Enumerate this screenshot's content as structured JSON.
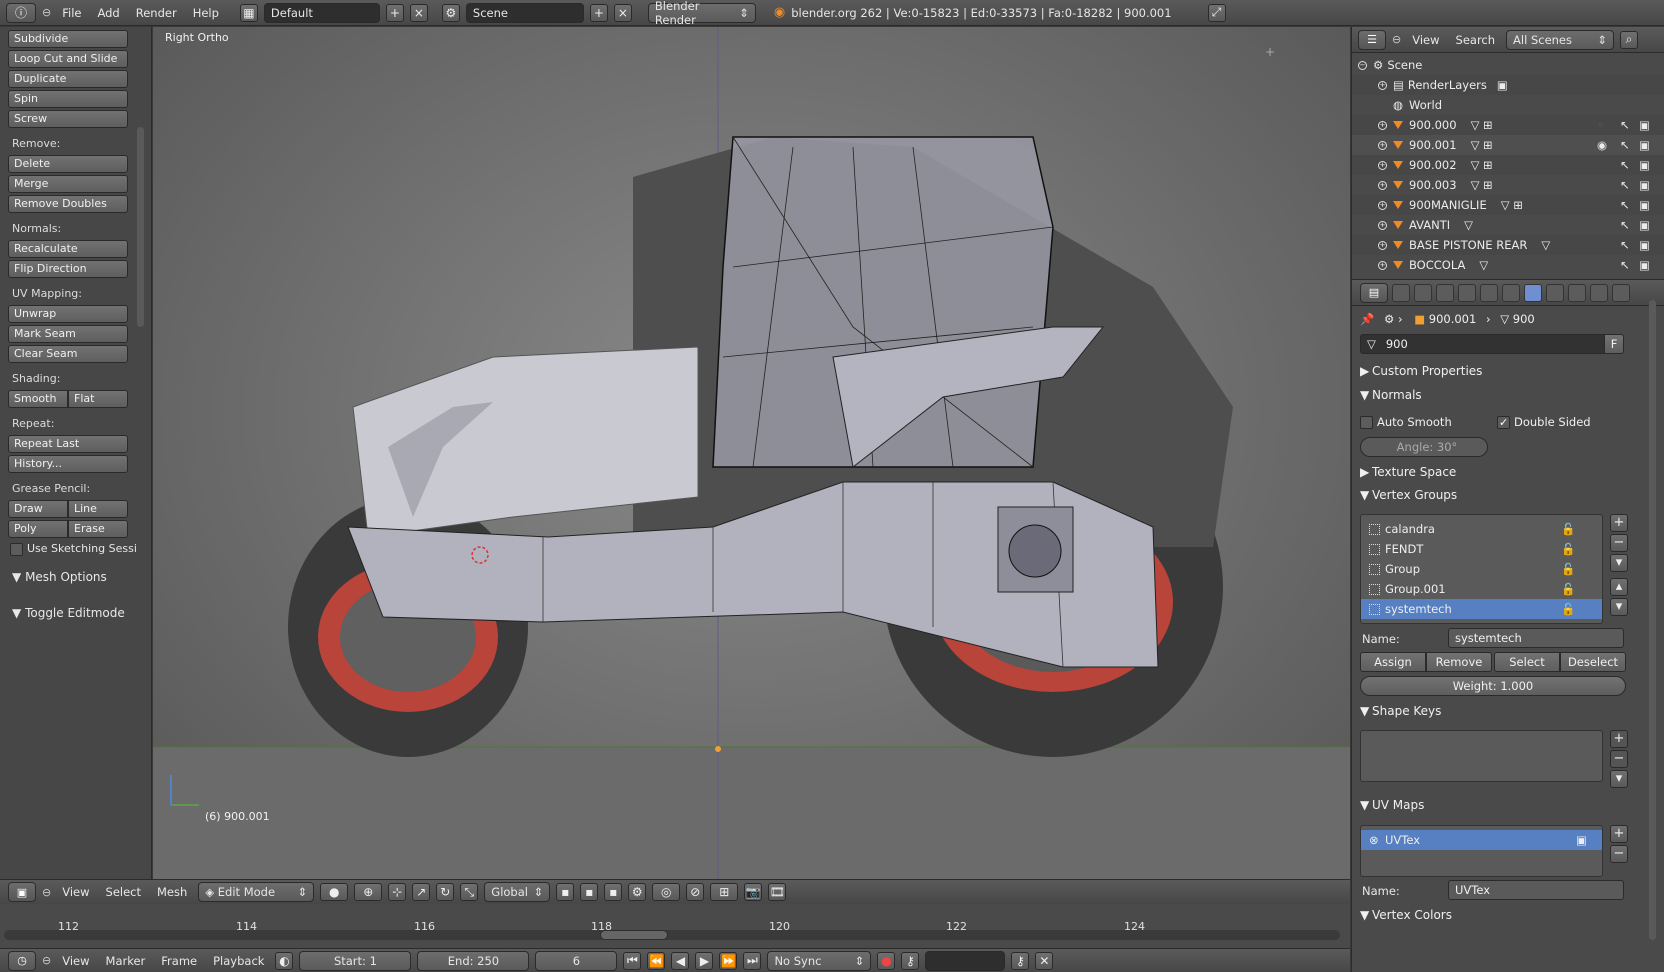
{
  "topbar": {
    "menus": [
      "File",
      "Add",
      "Render",
      "Help"
    ],
    "screen_layout": "Default",
    "scene": "Scene",
    "render_engine": "Blender Render",
    "stats": "blender.org 262 | Ve:0-15823 | Ed:0-33573 | Fa:0-18282 | 900.001"
  },
  "toolshelf": {
    "top_buttons": [
      "Subdivide",
      "Loop Cut and Slide",
      "Duplicate",
      "Spin",
      "Screw"
    ],
    "remove_label": "Remove:",
    "remove_buttons": [
      "Delete",
      "Merge",
      "Remove Doubles"
    ],
    "normals_label": "Normals:",
    "normals_buttons": [
      "Recalculate",
      "Flip Direction"
    ],
    "uv_label": "UV Mapping:",
    "uv_buttons": [
      "Unwrap",
      "Mark Seam",
      "Clear Seam"
    ],
    "shading_label": "Shading:",
    "shading_smooth": "Smooth",
    "shading_flat": "Flat",
    "repeat_label": "Repeat:",
    "repeat_buttons": [
      "Repeat Last",
      "History..."
    ],
    "grease_label": "Grease Pencil:",
    "grease_draw": "Draw",
    "grease_line": "Line",
    "grease_poly": "Poly",
    "grease_erase": "Erase",
    "sketching": "Use Sketching Sessi",
    "mesh_options": "Mesh Options",
    "toggle_editmode": "Toggle Editmode"
  },
  "viewport": {
    "view_name": "Right Ortho",
    "object_info": "(6) 900.001"
  },
  "view_header": {
    "menus": [
      "View",
      "Select",
      "Mesh"
    ],
    "mode": "Edit Mode",
    "orientation": "Global"
  },
  "timeline": {
    "ticks": [
      "112",
      "114",
      "116",
      "118",
      "120",
      "122",
      "124"
    ],
    "menus": [
      "View",
      "Marker",
      "Frame",
      "Playback"
    ],
    "start": "Start: 1",
    "end": "End: 250",
    "current": "6",
    "sync": "No Sync"
  },
  "outliner": {
    "menus": [
      "View",
      "Search"
    ],
    "filter": "All Scenes",
    "items": [
      {
        "name": "Scene",
        "kind": "scene"
      },
      {
        "name": "RenderLayers",
        "kind": "renderlayers"
      },
      {
        "name": "World",
        "kind": "world"
      },
      {
        "name": "900.000",
        "kind": "mesh"
      },
      {
        "name": "900.001",
        "kind": "mesh"
      },
      {
        "name": "900.002",
        "kind": "mesh"
      },
      {
        "name": "900.003",
        "kind": "mesh"
      },
      {
        "name": "900MANIGLIE",
        "kind": "mesh"
      },
      {
        "name": "AVANTI",
        "kind": "mesh"
      },
      {
        "name": "BASE PISTONE REAR",
        "kind": "mesh"
      },
      {
        "name": "BOCCOLA",
        "kind": "mesh"
      }
    ]
  },
  "properties": {
    "breadcrumb_object": "900.001",
    "breadcrumb_mesh": "900",
    "mesh_name": "900",
    "fake_user": "F",
    "custom_properties": "Custom Properties",
    "normals": "Normals",
    "auto_smooth": "Auto Smooth",
    "double_sided": "Double Sided",
    "angle": "Angle: 30°",
    "texture_space": "Texture Space",
    "vertex_groups": "Vertex Groups",
    "groups": [
      "calandra",
      "FENDT",
      "Group",
      "Group.001",
      "systemtech"
    ],
    "name_label": "Name:",
    "vg_name": "systemtech",
    "assign": "Assign",
    "remove": "Remove",
    "select": "Select",
    "deselect": "Deselect",
    "weight": "Weight: 1.000",
    "shape_keys": "Shape Keys",
    "uv_maps": "UV Maps",
    "uv_map_item": "UVTex",
    "uv_name_label": "Name:",
    "uv_name": "UVTex",
    "vertex_colors": "Vertex Colors"
  },
  "colors": {
    "accent_blue": "#5680c2",
    "wheel_red": "#b8443a",
    "mesh_orange": "#f08a24"
  }
}
